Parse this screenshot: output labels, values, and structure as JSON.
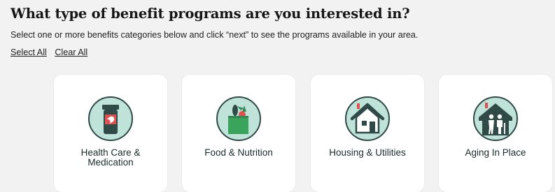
{
  "heading": "What type of benefit programs are you interested in?",
  "subtitle": "Select one or more benefits categories below and click “next” to see the programs available in your area.",
  "actions": {
    "select_all": "Select All",
    "clear_all": "Clear All"
  },
  "categories": [
    {
      "label": "Health Care & Medication",
      "icon": "medication-bottle-icon"
    },
    {
      "label": "Food & Nutrition",
      "icon": "grocery-bag-icon"
    },
    {
      "label": "Housing & Utilities",
      "icon": "house-icon"
    },
    {
      "label": "Aging In Place",
      "icon": "elderly-couple-house-icon"
    }
  ],
  "colors": {
    "icon_background": "#bfe3d8",
    "icon_outline": "#2f4a47",
    "accent_red": "#e0504f",
    "page_background": "#f2f2f2",
    "card_background": "#ffffff"
  }
}
